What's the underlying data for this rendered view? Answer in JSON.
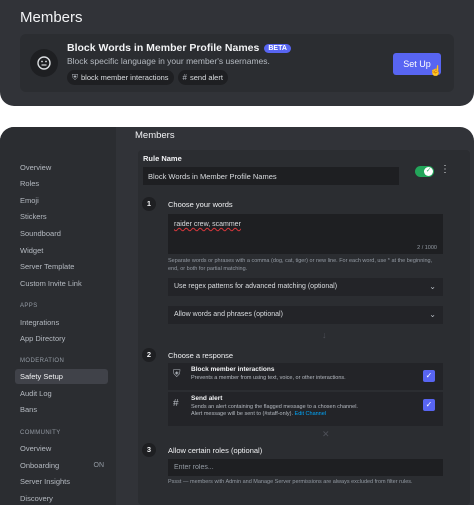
{
  "top": {
    "title": "Members",
    "feature": {
      "title": "Block Words in Member Profile Names",
      "badge": "BETA",
      "description": "Block specific language in your member's usernames.",
      "chips": [
        {
          "icon": "shield-icon",
          "label": "block member interactions"
        },
        {
          "icon": "hash-icon",
          "label": "send alert"
        }
      ],
      "button": "Set Up"
    }
  },
  "sidebar": {
    "items": [
      {
        "label": "Overview"
      },
      {
        "label": "Roles"
      },
      {
        "label": "Emoji"
      },
      {
        "label": "Stickers"
      },
      {
        "label": "Soundboard"
      },
      {
        "label": "Widget"
      },
      {
        "label": "Server Template"
      },
      {
        "label": "Custom Invite Link"
      }
    ],
    "apps_header": "APPS",
    "apps_items": [
      {
        "label": "Integrations"
      },
      {
        "label": "App Directory"
      }
    ],
    "moderation_header": "MODERATION",
    "moderation_items": [
      {
        "label": "Safety Setup",
        "active": true
      },
      {
        "label": "Audit Log"
      },
      {
        "label": "Bans"
      }
    ],
    "community_header": "COMMUNITY",
    "community_items": [
      {
        "label": "Overview"
      },
      {
        "label": "Onboarding",
        "badge": "ON"
      },
      {
        "label": "Server Insights"
      },
      {
        "label": "Discovery"
      }
    ]
  },
  "main": {
    "title": "Members",
    "rule_name_label": "Rule Name",
    "rule_name_value": "Block Words in Member Profile Names",
    "toggle_on": true,
    "steps": [
      {
        "number": "1",
        "title": "Choose your words"
      },
      {
        "number": "2",
        "title": "Choose a response"
      },
      {
        "number": "3",
        "title": "Allow certain roles (optional)"
      }
    ],
    "words_value": "raider crew, scammer",
    "words_counter": "2 / 1000",
    "words_help": "Separate words or phrases with a comma (dog, cat, tiger) or new line. For each word, use * at the beginning, end, or both for partial matching.",
    "regex_label": "Use regex patterns for advanced matching (optional)",
    "allow_label": "Allow words and phrases (optional)",
    "responses": [
      {
        "icon": "shield-icon",
        "title": "Block member interactions",
        "description": "Prevents a member from using text, voice, or other interactions."
      },
      {
        "icon": "hash-icon",
        "title": "Send alert",
        "description": "Sends an alert containing the flagged message to a chosen channel.",
        "description2": "Alert message will be sent to (#staff-only).",
        "link": "Edit Channel"
      }
    ],
    "roles_placeholder": "Enter roles...",
    "roles_note": "Pssst — members with Admin and Manage Server permissions are always excluded from filter rules."
  }
}
